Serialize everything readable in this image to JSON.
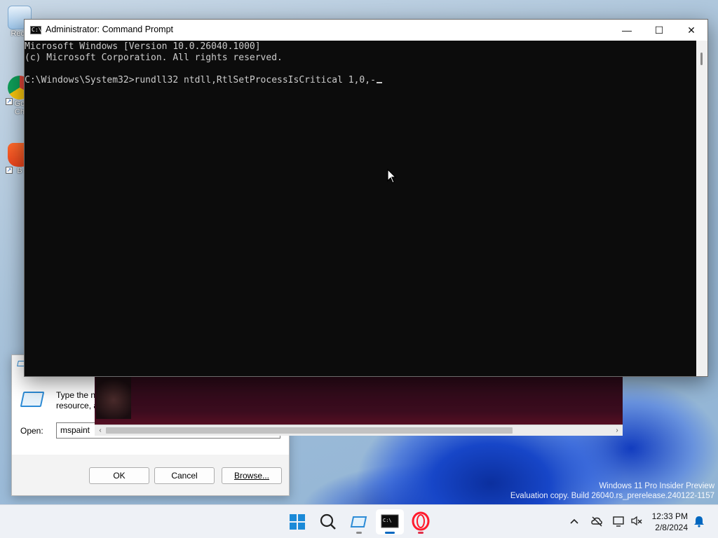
{
  "cmd": {
    "title": "Administrator: Command Prompt",
    "icon_text": "C:\\",
    "lines": [
      "Microsoft Windows [Version 10.0.26040.1000]",
      "(c) Microsoft Corporation. All rights reserved.",
      "",
      "C:\\Windows\\System32>rundll32 ntdll,RtlSetProcessIsCritical 1,0,-"
    ],
    "minimize_glyph": "—",
    "maximize_glyph": "☐",
    "close_glyph": "✕"
  },
  "run_dialog": {
    "description_line1": "Type the n",
    "description_line2": "resource, a",
    "open_label": "Open:",
    "open_value": "mspaint",
    "ok_label": "OK",
    "cancel_label": "Cancel",
    "browse_label": "Browse..."
  },
  "desktop": {
    "icons": [
      {
        "label": "Recy",
        "icon": "recycle-bin-icon"
      },
      {
        "label": "Go",
        "label2": "Ch",
        "icon": "chrome-icon"
      },
      {
        "label": "B",
        "icon": "brave-icon"
      }
    ],
    "watermark_line1": "Windows 11 Pro Insider Preview",
    "watermark_line2": "Evaluation copy. Build 26040.rs_prerelease.240122-1157"
  },
  "taskbar": {
    "apps": [
      "start-icon",
      "search-icon",
      "run-icon",
      "command-prompt-icon",
      "opera-icon"
    ],
    "clock_time": "12:33 PM",
    "clock_date": "2/8/2024",
    "tray_icons": [
      "chevron-up-icon",
      "cloud-off-icon",
      "network-icon",
      "volume-mute-icon",
      "notification-icon"
    ]
  },
  "colors": {
    "console_bg": "#0c0c0c",
    "console_fg": "#cccccc",
    "accent": "#0067c0"
  }
}
